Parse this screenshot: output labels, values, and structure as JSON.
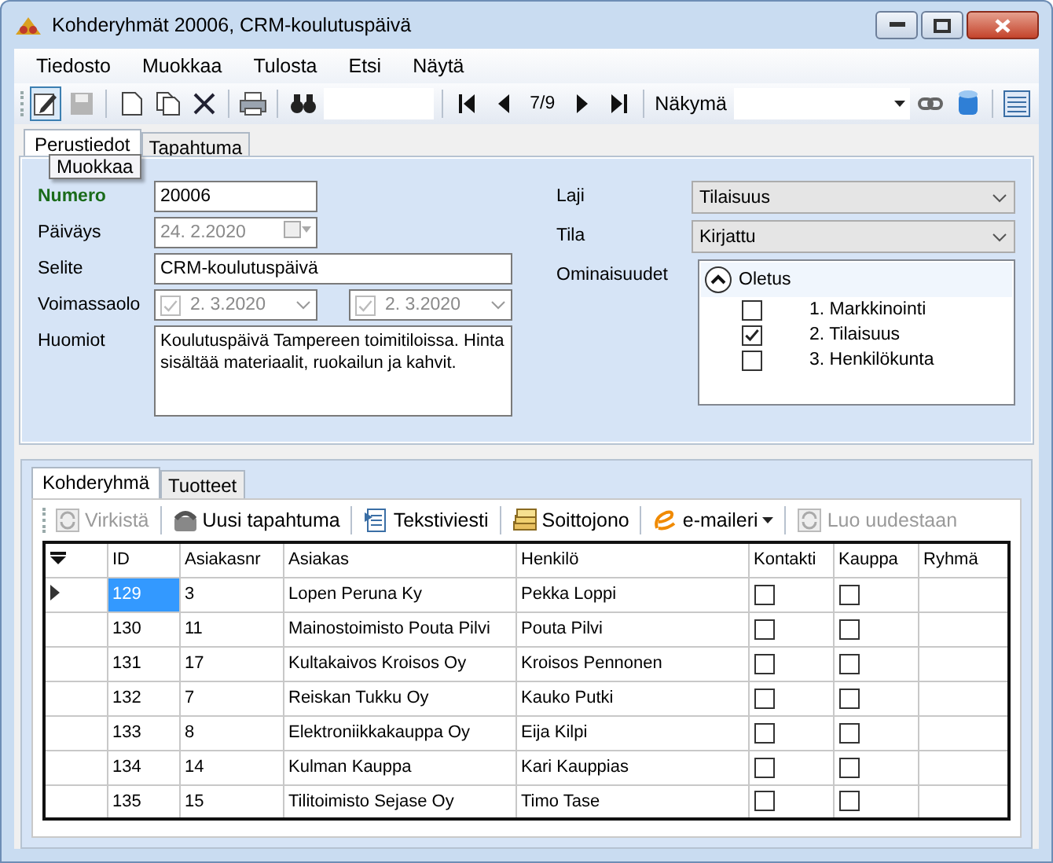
{
  "window": {
    "title": "Kohderyhmät 20006, CRM-koulutuspäivä"
  },
  "menu": [
    "Tiedosto",
    "Muokkaa",
    "Tulosta",
    "Etsi",
    "Näytä"
  ],
  "toolbar": {
    "edit_selected": true,
    "save_disabled": true,
    "record": "7/9",
    "view_label": "Näkymä",
    "tooltip": "Muokkaa"
  },
  "tabs": [
    {
      "label": "Perustiedot",
      "selected": true
    },
    {
      "label": "Tapahtuma",
      "selected": false
    }
  ],
  "fields": [
    {
      "kind": "text",
      "label": "Numero",
      "required": true,
      "value": "20006"
    },
    {
      "kind": "date",
      "label": "Päiväys",
      "disabled": true,
      "value": "24. 2.2020"
    },
    {
      "kind": "wide",
      "label": "Selite",
      "value": "CRM-koulutuspäivä"
    },
    {
      "kind": "range",
      "label": "Voimassaolo",
      "disabled": true,
      "dates": [
        {
          "value": "2. 3.2020",
          "checked": true
        },
        {
          "value": "2. 3.2020",
          "checked": true
        }
      ]
    },
    {
      "kind": "memo",
      "label": "Huomiot",
      "value": "Koulutuspäivä Tampereen toimitiloissa. Hinta sisältää materiaalit, ruokailun ja kahvit."
    }
  ],
  "dropdowns": [
    {
      "label": "Laji",
      "value": "Tilaisuus"
    },
    {
      "label": "Tila",
      "value": "Kirjattu"
    }
  ],
  "properties": {
    "label": "Ominaisuudet",
    "group": "Oletus",
    "expanded": true,
    "items": [
      {
        "label": "1. Markkinointi",
        "checked": false
      },
      {
        "label": "2. Tilaisuus",
        "checked": true
      },
      {
        "label": "3. Henkilökunta",
        "checked": false
      }
    ]
  },
  "lower_tabs": [
    {
      "label": "Kohderyhmä",
      "selected": true
    },
    {
      "label": "Tuotteet",
      "selected": false
    }
  ],
  "actions": [
    {
      "label": "Virkistä",
      "disabled": true
    },
    {
      "label": "Uusi tapahtuma",
      "disabled": false
    },
    {
      "label": "Tekstiviesti",
      "disabled": false
    },
    {
      "label": "Soittojono",
      "disabled": false
    },
    {
      "label": "e-maileri",
      "disabled": false,
      "dropdown": true
    },
    {
      "label": "Luo uudestaan",
      "disabled": true
    }
  ],
  "table": {
    "columns": [
      "ID",
      "Asiakasnr",
      "Asiakas",
      "Henkilö",
      "Kontakti",
      "Kauppa",
      "Ryhmä"
    ],
    "rows": [
      {
        "selected": true,
        "id": "129",
        "asiakasnr": "3",
        "asiakas": "Lopen Peruna Ky",
        "henkilo": "Pekka Loppi",
        "kontakti": false,
        "kauppa": false
      },
      {
        "selected": false,
        "id": "130",
        "asiakasnr": "11",
        "asiakas": "Mainostoimisto Pouta Pilvi",
        "henkilo": "Pouta Pilvi",
        "kontakti": false,
        "kauppa": false
      },
      {
        "selected": false,
        "id": "131",
        "asiakasnr": "17",
        "asiakas": "Kultakaivos Kroisos Oy",
        "henkilo": "Kroisos Pennonen",
        "kontakti": false,
        "kauppa": false
      },
      {
        "selected": false,
        "id": "132",
        "asiakasnr": "7",
        "asiakas": "Reiskan Tukku Oy",
        "henkilo": "Kauko Putki",
        "kontakti": false,
        "kauppa": false
      },
      {
        "selected": false,
        "id": "133",
        "asiakasnr": "8",
        "asiakas": "Elektroniikkakauppa Oy",
        "henkilo": "Eija Kilpi",
        "kontakti": false,
        "kauppa": false
      },
      {
        "selected": false,
        "id": "134",
        "asiakasnr": "14",
        "asiakas": "Kulman Kauppa",
        "henkilo": "Kari Kauppias",
        "kontakti": false,
        "kauppa": false
      },
      {
        "selected": false,
        "id": "135",
        "asiakasnr": "15",
        "asiakas": "Tilitoimisto Sejase Oy",
        "henkilo": "Timo Tase",
        "kontakti": false,
        "kauppa": false
      }
    ]
  }
}
